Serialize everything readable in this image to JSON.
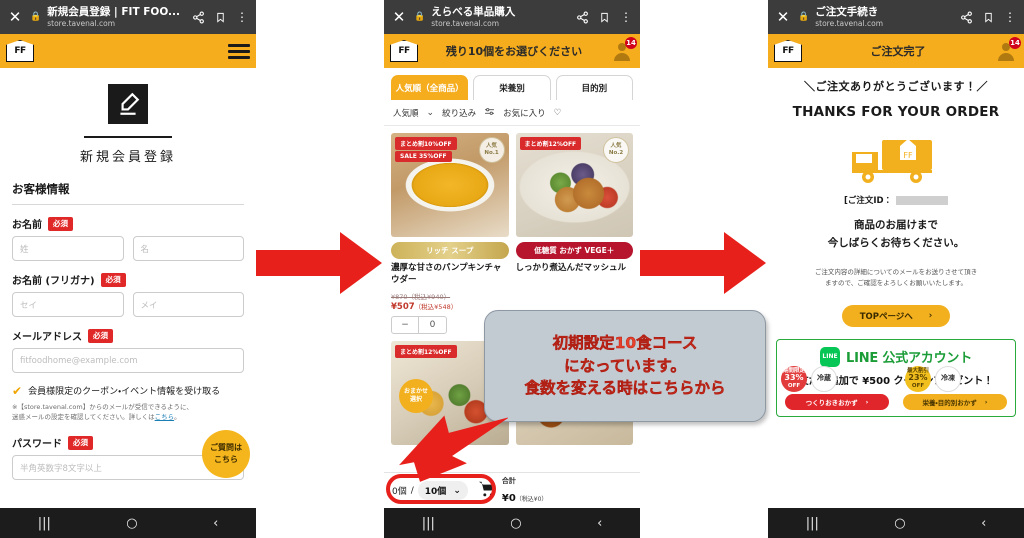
{
  "panels": {
    "left": {
      "browser": {
        "title": "新規会員登録 | FIT FOO...",
        "url": "store.tavenal.com",
        "close_icon": "close-icon",
        "lock_icon": "lock-icon",
        "share_icon": "share-icon",
        "bookmark_icon": "bookmark-icon",
        "menu_icon": "overflow-menu-icon"
      },
      "header": {
        "logo": "FF",
        "menu_icon": "hamburger-menu-icon"
      },
      "hero": {
        "icon": "pencil-write-icon",
        "title": "新規会員登録"
      },
      "form": {
        "section_title": "お客様情報",
        "required_tag": "必須",
        "fields": [
          {
            "label": "お名前",
            "required": true,
            "inputs": [
              "姓",
              "名"
            ]
          },
          {
            "label": "お名前 (フリガナ)",
            "required": true,
            "inputs": [
              "セイ",
              "メイ"
            ]
          },
          {
            "label": "メールアドレス",
            "required": true,
            "inputs": [
              "fitfoodhome@example.com"
            ]
          },
          {
            "label": "パスワード",
            "required": true,
            "inputs": [
              "半角英数字8文字以上"
            ]
          }
        ],
        "consent": {
          "checked": true,
          "label": "会員様限定のクーポン・イベント情報を受け取る",
          "note_line1": "※【store.tavenal.com】からのメールが受信できるように、",
          "note_line2": "迷惑メールの設定を確認してください。詳しくは",
          "note_link": "こちら"
        }
      },
      "faq_bubble": {
        "line1": "ご質問は",
        "line2": "こちら"
      }
    },
    "mid": {
      "browser": {
        "title": "えらべる単品購入",
        "url": "store.tavenal.com",
        "close_icon": "close-icon",
        "lock_icon": "lock-icon",
        "share_icon": "share-icon",
        "bookmark_icon": "bookmark-icon",
        "menu_icon": "overflow-menu-icon"
      },
      "header": {
        "logo": "FF",
        "title": "残り10個をお選びください",
        "account_icon": "account-person-icon",
        "badge": "14"
      },
      "tabs": [
        {
          "label": "人気順（全商品）",
          "active": true
        },
        {
          "label": "栄養別",
          "active": false
        },
        {
          "label": "目的別",
          "active": false
        }
      ],
      "filters": {
        "sort": "人気順",
        "sort_icon": "chevron-down-icon",
        "refine": "絞り込み",
        "refine_icon": "sliders-icon",
        "favorite": "お気に入り",
        "favorite_icon": "heart-icon"
      },
      "products": [
        {
          "badges": [
            "まとめ割10%OFF",
            "SALE 35%OFF"
          ],
          "rank_label": "人気",
          "rank_value": "No.1",
          "pill": "リッチ スープ",
          "name": "濃厚な甘さのパンプキンチャウダー",
          "price_old": "¥870（税込¥940）",
          "price_new": "¥507",
          "price_tax": "（税込¥548）",
          "qty": "0",
          "minus_icon": "minus-icon"
        },
        {
          "badges": [
            "まとめ割12%OFF"
          ],
          "rank_label": "人気",
          "rank_value": "No.2",
          "pill": "低糖質 おかず VEGE＋",
          "name": "しっかり煮込んだマッシュル"
        },
        {
          "badges": [
            "まとめ割12%OFF"
          ],
          "omakase_line1": "おまかせ",
          "omakase_line2": "選択"
        },
        {
          "badges": []
        }
      ],
      "cart_bar": {
        "selected": "0個",
        "separator": "/",
        "total_qty": "10個",
        "chevron_icon": "chevron-down-icon",
        "cart_icon": "shopping-cart-icon",
        "total_label": "合計",
        "total_value": "¥0",
        "total_tax": "（税込¥0）"
      }
    },
    "right": {
      "browser": {
        "title": "ご注文手続き",
        "url": "store.tavenal.com",
        "close_icon": "close-icon",
        "lock_icon": "lock-icon",
        "share_icon": "share-icon",
        "bookmark_icon": "bookmark-icon",
        "menu_icon": "overflow-menu-icon"
      },
      "header": {
        "logo": "FF",
        "title": "ご注文完了",
        "account_icon": "account-person-icon",
        "badge": "14"
      },
      "thanks_jp": "＼ご注文ありがとうございます！／",
      "thanks_en": "THANKS FOR YOUR ORDER",
      "truck_icon": "delivery-truck-icon",
      "order_id_label": "[ご注文ID：",
      "order_id_value": "",
      "await_line1": "商品のお届けまで",
      "await_line2": "今しばらくお待ちください。",
      "mail_note_line1": "ご注文内容の詳細についてのメールをお送りさせて頂き",
      "mail_note_line2": "ますので、ご確認をよろしくお願いいたします。",
      "top_button": {
        "label": "TOPページへ",
        "icon": "chevron-right-icon"
      },
      "line_banner": {
        "logo_text": "LINE",
        "title": "LINE 公式アカウント",
        "sub_prefix": "友だち追加で",
        "amount": "¥500",
        "sub_suffix": "クーポンプレゼント！",
        "floaties": [
          {
            "top": "期間限定",
            "value": "33%",
            "bottom": "OFF",
            "style": "red"
          },
          {
            "value": "冷蔵",
            "style": "white"
          },
          {
            "top": "最大割引",
            "value": "23%",
            "bottom": "OFF",
            "style": "yellow"
          },
          {
            "value": "冷凍",
            "style": "white"
          }
        ],
        "btn_red": "つくりおきおかず",
        "btn_red_icon": "chevron-right-icon",
        "btn_yellow": "栄養・目的別おかず",
        "btn_yellow_icon": "chevron-right-icon"
      }
    }
  },
  "callout": {
    "line1": "初期設定10食コース",
    "line2": "になっています。",
    "line3": "食数を変える時はこちらから"
  },
  "nav_bar": {
    "recents": "|||",
    "home": "○",
    "back": "‹"
  },
  "colors": {
    "brand_yellow": "#f5ac1d",
    "accent_red": "#e8201b",
    "line_green": "#06c755",
    "required_red": "#e02828"
  }
}
